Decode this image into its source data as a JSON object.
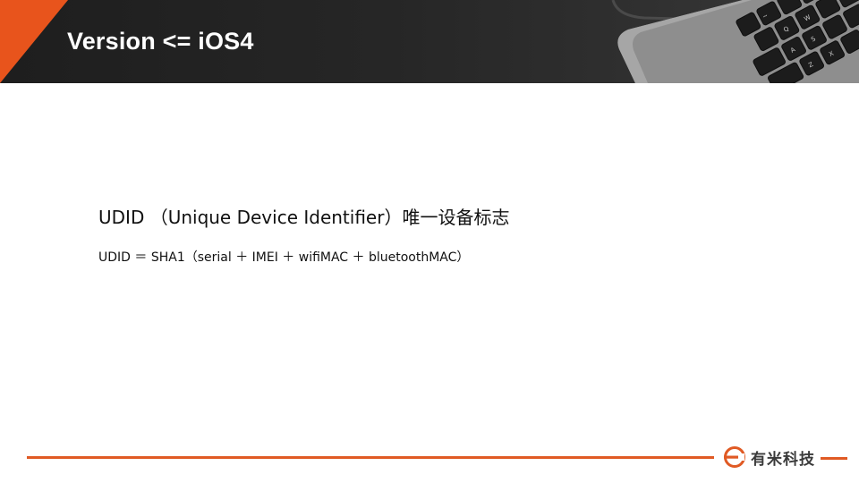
{
  "slide": {
    "title": "Version <= iOS4",
    "lines": [
      "UDID （Unique Device Identifier）唯一设备标志",
      "UDID ＝ SHA1（serial ＋ IMEI ＋ wifiMAC ＋ bluetoothMAC）"
    ]
  },
  "footer": {
    "brand_name": "有米科技"
  },
  "colors": {
    "accent": "#e05a24",
    "header_bg": "#262626",
    "title_text": "#ffffff",
    "body_text": "#111111"
  },
  "icons": {
    "header_decoration": "laptop-keyboard-icon",
    "brand_logo": "youmi-logo-icon"
  }
}
